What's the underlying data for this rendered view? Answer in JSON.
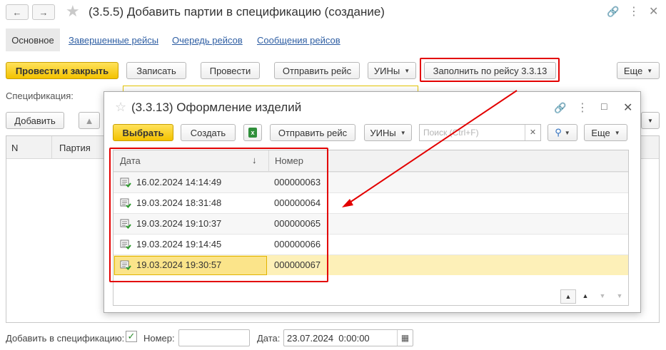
{
  "header": {
    "back_icon": "arrow-left-icon",
    "forward_icon": "arrow-right-icon",
    "star_icon": "star-icon",
    "title": "(3.5.5) Добавить партии в спецификацию (создание)",
    "link_icon": "link-icon",
    "more_icon": "more-icon",
    "close_icon": "close-icon"
  },
  "tabs": {
    "active": "Основное",
    "links": [
      "Завершенные рейсы",
      "Очередь рейсов",
      "Сообщения рейсов"
    ]
  },
  "toolbar": {
    "post_close": "Провести и закрыть",
    "save": "Записать",
    "post": "Провести",
    "send_trip": "Отправить рейс",
    "uins": "УИНы",
    "fill_by_trip": "Заполнить по рейсу 3.3.13",
    "more": "Еще"
  },
  "spec": {
    "label": "Спецификация:",
    "add": "Добавить",
    "col_n": "N",
    "col_batch": "Партия"
  },
  "dialog": {
    "title": "(3.3.13) Оформление изделий",
    "select": "Выбрать",
    "create": "Создать",
    "send_trip": "Отправить рейс",
    "uins": "УИНы",
    "search_placeholder": "Поиск (Ctrl+F)",
    "more": "Еще",
    "col_date": "Дата",
    "col_number": "Номер",
    "rows": [
      {
        "date": "16.02.2024 14:14:49",
        "number": "000000063"
      },
      {
        "date": "19.03.2024 18:31:48",
        "number": "000000064"
      },
      {
        "date": "19.03.2024 19:10:37",
        "number": "000000065"
      },
      {
        "date": "19.03.2024 19:14:45",
        "number": "000000066"
      },
      {
        "date": "19.03.2024 19:30:57",
        "number": "000000067"
      }
    ],
    "selected_row": 4
  },
  "footer": {
    "add_to_spec_label": "Добавить в спецификацию:",
    "add_to_spec_checked": true,
    "number_label": "Номер:",
    "number_value": "",
    "date_label": "Дата:",
    "date_value": "23.07.2024  0:00:00"
  },
  "colors": {
    "accent_yellow": "#f7cf1d",
    "highlight_red": "#e30000",
    "selected_row": "#fdf0b8",
    "link_blue": "#2e5ea3"
  }
}
